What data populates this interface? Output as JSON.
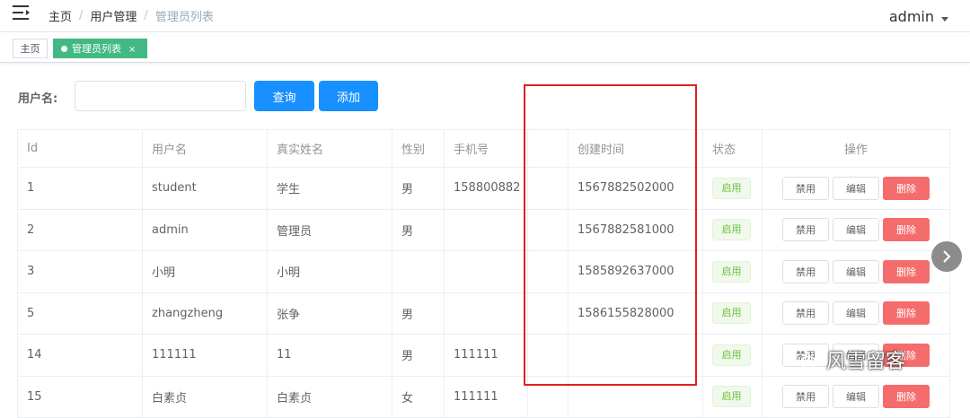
{
  "header": {
    "breadcrumb": [
      "主页",
      "用户管理",
      "管理员列表"
    ],
    "breadcrumb_sep": "/",
    "username": "admin"
  },
  "tags": {
    "home": "主页",
    "active": "管理员列表",
    "close": "×"
  },
  "filter": {
    "label": "用户名:",
    "input_value": "",
    "query_label": "查询",
    "add_label": "添加"
  },
  "table": {
    "columns": [
      "Id",
      "用户名",
      "真实姓名",
      "性别",
      "手机号",
      "",
      "创建时间",
      "状态",
      "操作"
    ],
    "rows": [
      {
        "id": "1",
        "username": "student",
        "realname": "学生",
        "gender": "男",
        "phone": "158800882",
        "blank": "",
        "created": "1567882502000",
        "status": "启用"
      },
      {
        "id": "2",
        "username": "admin",
        "realname": "管理员",
        "gender": "男",
        "phone": "",
        "blank": "",
        "created": "1567882581000",
        "status": "启用"
      },
      {
        "id": "3",
        "username": "小明",
        "realname": "小明",
        "gender": "",
        "phone": "",
        "blank": "",
        "created": "1585892637000",
        "status": "启用"
      },
      {
        "id": "5",
        "username": "zhangzheng",
        "realname": "张争",
        "gender": "男",
        "phone": "",
        "blank": "",
        "created": "1586155828000",
        "status": "启用"
      },
      {
        "id": "14",
        "username": "111111",
        "realname": "11",
        "gender": "男",
        "phone": "111111",
        "blank": "",
        "created": "",
        "status": "启用"
      },
      {
        "id": "15",
        "username": "白素贞",
        "realname": "白素贞",
        "gender": "女",
        "phone": "111111",
        "blank": "",
        "created": "",
        "status": "启用"
      }
    ],
    "actions": {
      "disable": "禁用",
      "edit": "编辑",
      "delete": "删除"
    }
  },
  "watermark": {
    "text": "风雪留客"
  },
  "colors": {
    "primary": "#1890ff",
    "tag_active": "#42b983",
    "danger": "#f56c6c",
    "success": "#67c23a",
    "highlight": "#e02020"
  },
  "icons": {
    "menu": "hamburger-icon",
    "caret": "caret-down-icon",
    "scroll": "chevron-right-icon",
    "watermark": "wechat-icon"
  }
}
